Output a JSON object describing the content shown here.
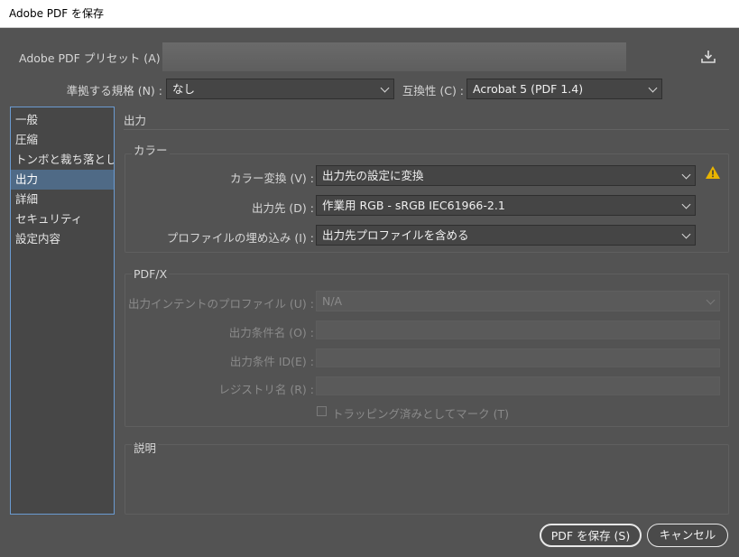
{
  "window": {
    "title": "Adobe PDF を保存"
  },
  "header": {
    "preset_label": "Adobe PDF プリセット (A) :",
    "standard_label": "準拠する規格 (N) :",
    "standard_value": "なし",
    "compat_label": "互換性 (C) :",
    "compat_value": "Acrobat 5 (PDF 1.4)",
    "save_preset_icon": "download-icon"
  },
  "sidebar": {
    "items": [
      {
        "label": "一般",
        "selected": false
      },
      {
        "label": "圧縮",
        "selected": false
      },
      {
        "label": "トンボと裁ち落とし",
        "selected": false
      },
      {
        "label": "出力",
        "selected": true
      },
      {
        "label": "詳細",
        "selected": false
      },
      {
        "label": "セキュリティ",
        "selected": false
      },
      {
        "label": "設定内容",
        "selected": false
      }
    ]
  },
  "main": {
    "section_title": "出力",
    "color": {
      "title": "カラー",
      "conversion_label": "カラー変換 (V) :",
      "conversion_value": "出力先の設定に変換",
      "destination_label": "出力先 (D) :",
      "destination_value": "作業用 RGB - sRGB IEC61966-2.1",
      "profile_label": "プロファイルの埋め込み (I) :",
      "profile_value": "出力先プロファイルを含める",
      "warning_icon": "warning-icon"
    },
    "pdfx": {
      "title": "PDF/X",
      "intent_label": "出力インテントのプロファイル (U) :",
      "intent_value": "N/A",
      "condition_name_label": "出力条件名 (O) :",
      "condition_id_label": "出力条件 ID(E) :",
      "registry_label": "レジストリ名 (R) :",
      "trapping_label": "トラッピング済みとしてマーク (T)"
    },
    "description": {
      "title": "説明"
    }
  },
  "footer": {
    "save_label": "PDF を保存 (S)",
    "cancel_label": "キャンセル"
  },
  "colors": {
    "background": "#535353",
    "selection": "#4f6a86",
    "list_border": "#6b9bd1",
    "warning": "#e8b400"
  }
}
